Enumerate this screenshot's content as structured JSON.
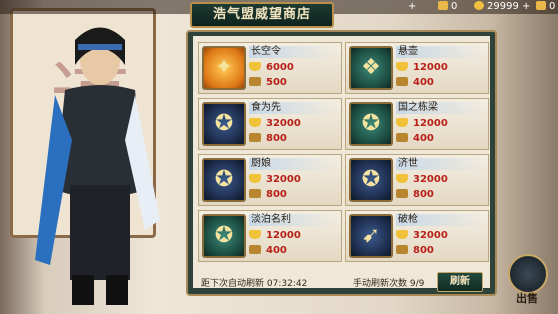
{
  "topbar": {
    "currency1_value": "0",
    "currency2_value": "29999",
    "currency3_value": "0",
    "plus_label": "+"
  },
  "shop": {
    "title": "浩气盟威望商店",
    "items": [
      {
        "name": "长空令",
        "price1": "6000",
        "price2": "500",
        "style": "gold",
        "icon": "command-token-icon"
      },
      {
        "name": "悬壶",
        "price1": "12000",
        "price2": "400",
        "style": "green",
        "icon": "gourd-badge-icon"
      },
      {
        "name": "食为先",
        "price1": "32000",
        "price2": "800",
        "style": "blue",
        "icon": "badge-icon"
      },
      {
        "name": "国之栋梁",
        "price1": "12000",
        "price2": "400",
        "style": "green",
        "icon": "badge-icon"
      },
      {
        "name": "厨娘",
        "price1": "32000",
        "price2": "800",
        "style": "blue",
        "icon": "badge-icon"
      },
      {
        "name": "济世",
        "price1": "32000",
        "price2": "800",
        "style": "blue",
        "icon": "badge-icon"
      },
      {
        "name": "淡泊名利",
        "price1": "12000",
        "price2": "400",
        "style": "green",
        "icon": "badge-icon"
      },
      {
        "name": "破枪",
        "price1": "32000",
        "price2": "800",
        "style": "blue",
        "icon": "spear-badge-icon"
      }
    ],
    "auto_refresh_label": "距下次自动刷新",
    "auto_refresh_time": "07:32:42",
    "manual_refresh_label": "手动刷新次数",
    "manual_refresh_count": "9/9",
    "refresh_button": "刷新"
  },
  "exit": {
    "label": "出售"
  },
  "colors": {
    "price_red": "#b8201a",
    "panel_green": "#2d4239",
    "gold_border": "#a88a58"
  }
}
